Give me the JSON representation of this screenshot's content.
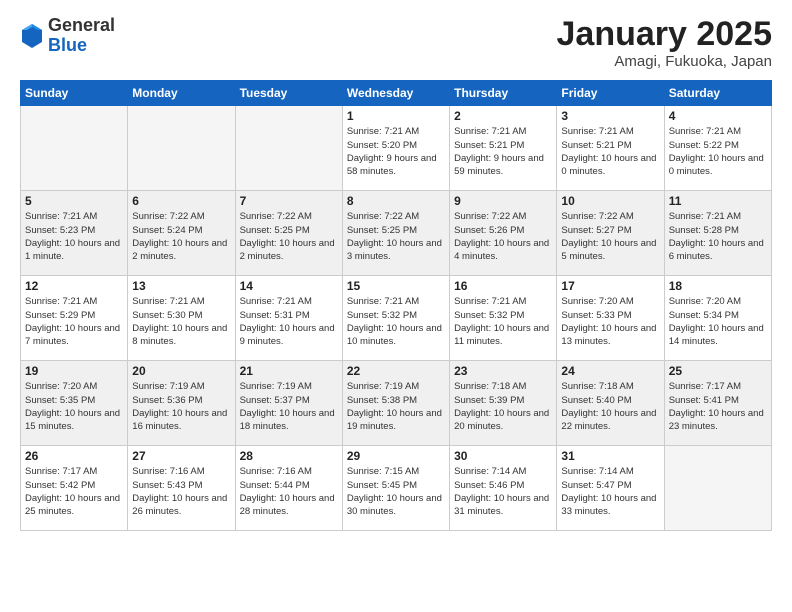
{
  "header": {
    "logo_general": "General",
    "logo_blue": "Blue",
    "month_title": "January 2025",
    "location": "Amagi, Fukuoka, Japan"
  },
  "days_of_week": [
    "Sunday",
    "Monday",
    "Tuesday",
    "Wednesday",
    "Thursday",
    "Friday",
    "Saturday"
  ],
  "weeks": [
    [
      {
        "day": "",
        "info": ""
      },
      {
        "day": "",
        "info": ""
      },
      {
        "day": "",
        "info": ""
      },
      {
        "day": "1",
        "info": "Sunrise: 7:21 AM\nSunset: 5:20 PM\nDaylight: 9 hours and 58 minutes."
      },
      {
        "day": "2",
        "info": "Sunrise: 7:21 AM\nSunset: 5:21 PM\nDaylight: 9 hours and 59 minutes."
      },
      {
        "day": "3",
        "info": "Sunrise: 7:21 AM\nSunset: 5:21 PM\nDaylight: 10 hours and 0 minutes."
      },
      {
        "day": "4",
        "info": "Sunrise: 7:21 AM\nSunset: 5:22 PM\nDaylight: 10 hours and 0 minutes."
      }
    ],
    [
      {
        "day": "5",
        "info": "Sunrise: 7:21 AM\nSunset: 5:23 PM\nDaylight: 10 hours and 1 minute."
      },
      {
        "day": "6",
        "info": "Sunrise: 7:22 AM\nSunset: 5:24 PM\nDaylight: 10 hours and 2 minutes."
      },
      {
        "day": "7",
        "info": "Sunrise: 7:22 AM\nSunset: 5:25 PM\nDaylight: 10 hours and 2 minutes."
      },
      {
        "day": "8",
        "info": "Sunrise: 7:22 AM\nSunset: 5:25 PM\nDaylight: 10 hours and 3 minutes."
      },
      {
        "day": "9",
        "info": "Sunrise: 7:22 AM\nSunset: 5:26 PM\nDaylight: 10 hours and 4 minutes."
      },
      {
        "day": "10",
        "info": "Sunrise: 7:22 AM\nSunset: 5:27 PM\nDaylight: 10 hours and 5 minutes."
      },
      {
        "day": "11",
        "info": "Sunrise: 7:21 AM\nSunset: 5:28 PM\nDaylight: 10 hours and 6 minutes."
      }
    ],
    [
      {
        "day": "12",
        "info": "Sunrise: 7:21 AM\nSunset: 5:29 PM\nDaylight: 10 hours and 7 minutes."
      },
      {
        "day": "13",
        "info": "Sunrise: 7:21 AM\nSunset: 5:30 PM\nDaylight: 10 hours and 8 minutes."
      },
      {
        "day": "14",
        "info": "Sunrise: 7:21 AM\nSunset: 5:31 PM\nDaylight: 10 hours and 9 minutes."
      },
      {
        "day": "15",
        "info": "Sunrise: 7:21 AM\nSunset: 5:32 PM\nDaylight: 10 hours and 10 minutes."
      },
      {
        "day": "16",
        "info": "Sunrise: 7:21 AM\nSunset: 5:32 PM\nDaylight: 10 hours and 11 minutes."
      },
      {
        "day": "17",
        "info": "Sunrise: 7:20 AM\nSunset: 5:33 PM\nDaylight: 10 hours and 13 minutes."
      },
      {
        "day": "18",
        "info": "Sunrise: 7:20 AM\nSunset: 5:34 PM\nDaylight: 10 hours and 14 minutes."
      }
    ],
    [
      {
        "day": "19",
        "info": "Sunrise: 7:20 AM\nSunset: 5:35 PM\nDaylight: 10 hours and 15 minutes."
      },
      {
        "day": "20",
        "info": "Sunrise: 7:19 AM\nSunset: 5:36 PM\nDaylight: 10 hours and 16 minutes."
      },
      {
        "day": "21",
        "info": "Sunrise: 7:19 AM\nSunset: 5:37 PM\nDaylight: 10 hours and 18 minutes."
      },
      {
        "day": "22",
        "info": "Sunrise: 7:19 AM\nSunset: 5:38 PM\nDaylight: 10 hours and 19 minutes."
      },
      {
        "day": "23",
        "info": "Sunrise: 7:18 AM\nSunset: 5:39 PM\nDaylight: 10 hours and 20 minutes."
      },
      {
        "day": "24",
        "info": "Sunrise: 7:18 AM\nSunset: 5:40 PM\nDaylight: 10 hours and 22 minutes."
      },
      {
        "day": "25",
        "info": "Sunrise: 7:17 AM\nSunset: 5:41 PM\nDaylight: 10 hours and 23 minutes."
      }
    ],
    [
      {
        "day": "26",
        "info": "Sunrise: 7:17 AM\nSunset: 5:42 PM\nDaylight: 10 hours and 25 minutes."
      },
      {
        "day": "27",
        "info": "Sunrise: 7:16 AM\nSunset: 5:43 PM\nDaylight: 10 hours and 26 minutes."
      },
      {
        "day": "28",
        "info": "Sunrise: 7:16 AM\nSunset: 5:44 PM\nDaylight: 10 hours and 28 minutes."
      },
      {
        "day": "29",
        "info": "Sunrise: 7:15 AM\nSunset: 5:45 PM\nDaylight: 10 hours and 30 minutes."
      },
      {
        "day": "30",
        "info": "Sunrise: 7:14 AM\nSunset: 5:46 PM\nDaylight: 10 hours and 31 minutes."
      },
      {
        "day": "31",
        "info": "Sunrise: 7:14 AM\nSunset: 5:47 PM\nDaylight: 10 hours and 33 minutes."
      },
      {
        "day": "",
        "info": ""
      }
    ]
  ]
}
